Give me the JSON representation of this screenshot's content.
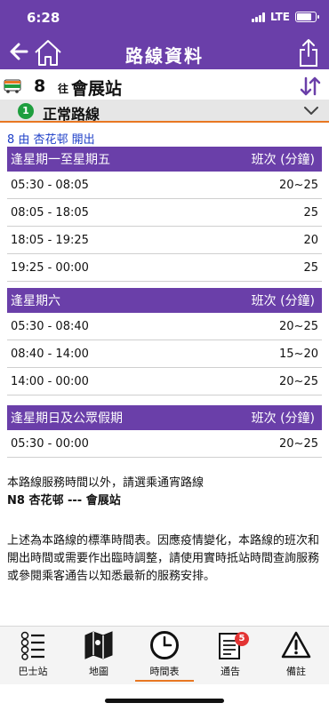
{
  "status": {
    "time": "6:28",
    "network": "LTE"
  },
  "nav": {
    "title": "路線資料"
  },
  "route": {
    "number": "8",
    "to_label": "往",
    "destination": "會展站"
  },
  "normal_route": {
    "badge": "1",
    "label": "正常路線"
  },
  "depart": "8 由 杏花邨 開出",
  "tables": [
    {
      "header": "逢星期一至星期五",
      "freq_header": "班次 (分鐘)",
      "rows": [
        {
          "time": "05:30 - 08:05",
          "freq": "20~25"
        },
        {
          "time": "08:05 - 18:05",
          "freq": "25"
        },
        {
          "time": "18:05 - 19:25",
          "freq": "20"
        },
        {
          "time": "19:25 - 00:00",
          "freq": "25"
        }
      ]
    },
    {
      "header": "逢星期六",
      "freq_header": "班次 (分鐘)",
      "rows": [
        {
          "time": "05:30 - 08:40",
          "freq": "20~25"
        },
        {
          "time": "08:40 - 14:00",
          "freq": "15~20"
        },
        {
          "time": "14:00 - 00:00",
          "freq": "20~25"
        }
      ]
    },
    {
      "header": "逢星期日及公眾假期",
      "freq_header": "班次 (分鐘)",
      "rows": [
        {
          "time": "05:30 - 00:00",
          "freq": "20~25"
        }
      ]
    }
  ],
  "note1": {
    "line1": "本路線服務時間以外，請選乘通宵路線",
    "line2": "N8 杏花邨 --- 會展站"
  },
  "note2": "上述為本路線的標準時間表。因應疫情變化，本路線的班次和開出時間或需要作出臨時調整，請使用實時抵站時間查詢服務或參閱乘客通告以知悉最新的服務安排。",
  "tabs": [
    {
      "label": "巴士站",
      "icon": "bus-stops-icon"
    },
    {
      "label": "地圖",
      "icon": "map-icon"
    },
    {
      "label": "時間表",
      "icon": "clock-icon"
    },
    {
      "label": "通告",
      "icon": "notice-icon",
      "badge": "5"
    },
    {
      "label": "備註",
      "icon": "warning-icon"
    }
  ],
  "colors": {
    "header": "#6a3fa9",
    "accent": "#e87722",
    "badge": "#1e9e3e",
    "depart_text": "#1f40c8"
  }
}
